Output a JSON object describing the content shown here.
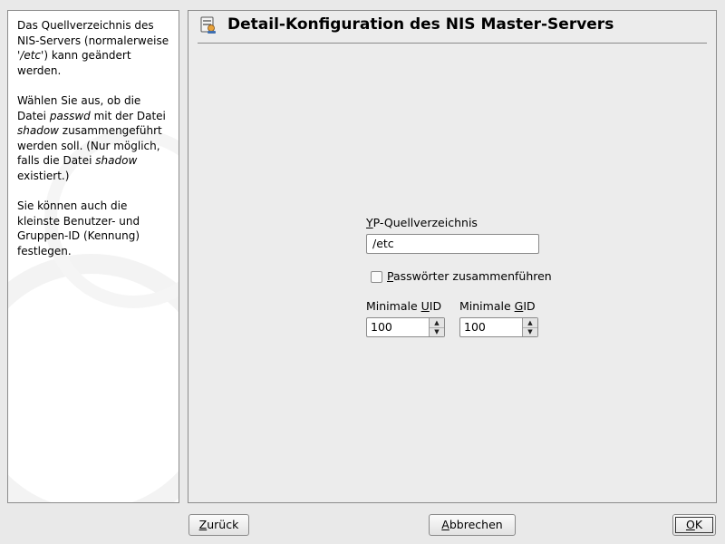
{
  "help": {
    "p1": {
      "text1": "Das Quellverzeichnis des NIS-Servers (normalerweise ",
      "em": "'/etc'",
      "text2": ") kann geändert werden."
    },
    "p2": {
      "text1": "Wählen Sie aus, ob die Datei ",
      "em1": "passwd",
      "text2": " mit der Datei ",
      "em2": "shadow",
      "text3": " zusammengeführt werden soll. (Nur möglich, falls die Datei ",
      "em3": "shadow",
      "text4": " existiert.)"
    },
    "p3": "Sie können auch die kleinste Benutzer- und Gruppen-ID (Kennung) festlegen."
  },
  "header": {
    "title": "Detail-Konfiguration des NIS Master-Servers",
    "icon": "server-config-icon"
  },
  "form": {
    "source_dir": {
      "label_mnemonic": "Y",
      "label_rest": "P-Quellverzeichnis",
      "value": "/etc"
    },
    "merge_passwords": {
      "label_mnemonic": "P",
      "label_rest": "asswörter zusammenführen",
      "checked": false
    },
    "min_uid": {
      "label_pre": "Minimale ",
      "label_mnemonic": "U",
      "label_rest": "ID",
      "value": "100"
    },
    "min_gid": {
      "label_pre": "Minimale ",
      "label_mnemonic": "G",
      "label_rest": "ID",
      "value": "100"
    }
  },
  "buttons": {
    "back": {
      "mnemonic": "Z",
      "rest": "urück"
    },
    "cancel": {
      "mnemonic": "A",
      "rest": "bbrechen"
    },
    "ok": {
      "mnemonic": "O",
      "rest": "K"
    }
  }
}
